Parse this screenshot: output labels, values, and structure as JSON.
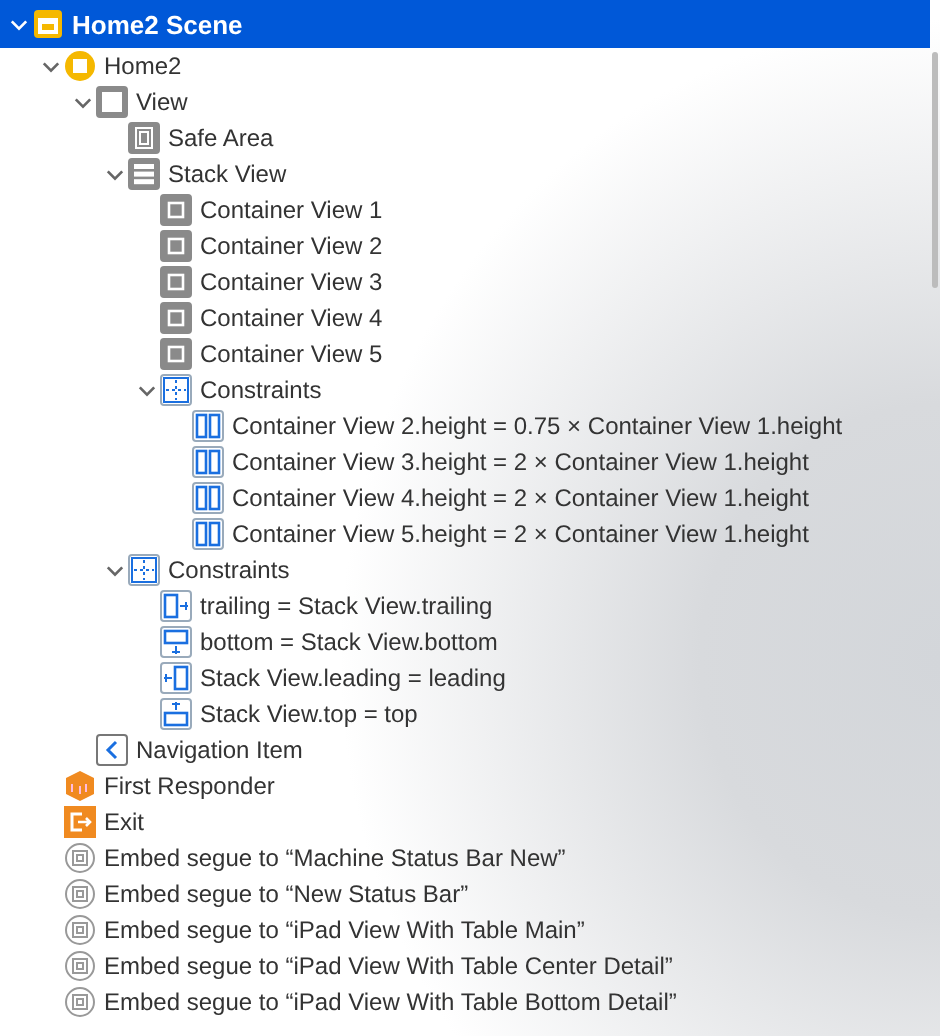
{
  "outline": [
    {
      "label": "Home2 Scene",
      "kind": "scene",
      "expanded": true,
      "selected": true,
      "children": [
        {
          "label": "Home2",
          "kind": "controller",
          "expanded": true,
          "selected": false,
          "children": [
            {
              "label": "View",
              "kind": "view",
              "expanded": true,
              "selected": false,
              "children": [
                {
                  "label": "Safe Area",
                  "kind": "safearea",
                  "selected": false
                },
                {
                  "label": "Stack View",
                  "kind": "stack",
                  "expanded": true,
                  "selected": false,
                  "children": [
                    {
                      "label": "Container View 1",
                      "kind": "container",
                      "selected": false
                    },
                    {
                      "label": "Container View 2",
                      "kind": "container",
                      "selected": false
                    },
                    {
                      "label": "Container View 3",
                      "kind": "container",
                      "selected": false
                    },
                    {
                      "label": "Container View 4",
                      "kind": "container",
                      "selected": false
                    },
                    {
                      "label": "Container View 5",
                      "kind": "container",
                      "selected": false
                    },
                    {
                      "label": "Constraints",
                      "kind": "constraints",
                      "expanded": true,
                      "selected": false,
                      "children": [
                        {
                          "label": "Container View 2.height = 0.75 × Container View 1.height",
                          "kind": "height",
                          "selected": false
                        },
                        {
                          "label": "Container View 3.height = 2 × Container View 1.height",
                          "kind": "height",
                          "selected": false
                        },
                        {
                          "label": "Container View 4.height = 2 × Container View 1.height",
                          "kind": "height",
                          "selected": false
                        },
                        {
                          "label": "Container View 5.height = 2 × Container View 1.height",
                          "kind": "height",
                          "selected": false
                        }
                      ]
                    }
                  ]
                },
                {
                  "label": "Constraints",
                  "kind": "constraints",
                  "expanded": true,
                  "selected": false,
                  "children": [
                    {
                      "label": "trailing = Stack View.trailing",
                      "kind": "trailing",
                      "selected": false
                    },
                    {
                      "label": "bottom = Stack View.bottom",
                      "kind": "bottom",
                      "selected": false
                    },
                    {
                      "label": "Stack View.leading = leading",
                      "kind": "leading",
                      "selected": false
                    },
                    {
                      "label": "Stack View.top = top",
                      "kind": "top",
                      "selected": false
                    }
                  ]
                }
              ]
            },
            {
              "label": "Navigation Item",
              "kind": "navitem",
              "selected": false
            }
          ]
        },
        {
          "label": "First Responder",
          "kind": "responder",
          "selected": false
        },
        {
          "label": "Exit",
          "kind": "exit",
          "selected": false
        },
        {
          "label": "Embed segue to “Machine Status Bar New”",
          "kind": "segue",
          "selected": false
        },
        {
          "label": "Embed segue to “New Status Bar”",
          "kind": "segue",
          "selected": false
        },
        {
          "label": "Embed segue to “iPad View With Table Main”",
          "kind": "segue",
          "selected": false
        },
        {
          "label": "Embed segue to “iPad View With Table Center Detail”",
          "kind": "segue",
          "selected": false
        },
        {
          "label": "Embed segue to “iPad View With Table Bottom Detail”",
          "kind": "segue",
          "selected": false
        }
      ]
    }
  ]
}
